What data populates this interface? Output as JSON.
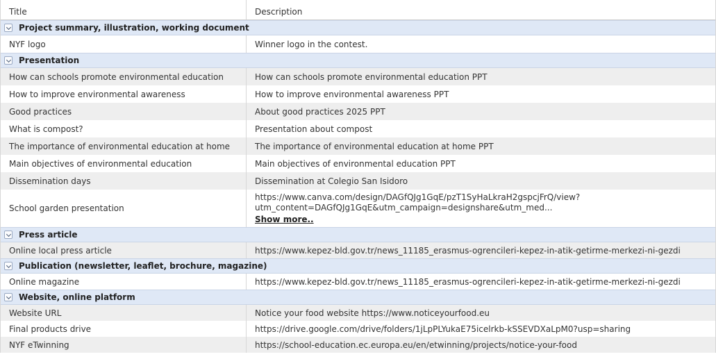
{
  "columns": {
    "title": "Title",
    "description": "Description"
  },
  "groups": [
    {
      "label": "Project summary, illustration, working document",
      "rows": [
        {
          "title": "NYF logo",
          "description": "Winner logo in the contest."
        }
      ]
    },
    {
      "label": "Presentation",
      "rows": [
        {
          "title": "How can schools promote environmental education",
          "description": "How can schools promote environmental education PPT"
        },
        {
          "title": "How to improve environmental awareness",
          "description": "How to improve environmental awareness PPT"
        },
        {
          "title": "Good practices",
          "description": "About good practices 2025 PPT"
        },
        {
          "title": "What is compost?",
          "description": "Presentation about compost"
        },
        {
          "title": "The importance of environmental education at home",
          "description": "The importance of environmental education at home PPT"
        },
        {
          "title": "Main objectives of environmental education",
          "description": "Main objectives of environmental education PPT"
        },
        {
          "title": "Dissemination days",
          "description": "Dissemination at Colegio San Isidoro"
        },
        {
          "title": "School garden presentation",
          "description_line1": "https://www.canva.com/design/DAGfQJg1GqE/pzT1SyHaLkraH2gspcjFrQ/view?",
          "description_line2": "utm_content=DAGfQJg1GqE&utm_campaign=designshare&utm_med...",
          "show_more": "Show more.."
        }
      ]
    },
    {
      "label": "Press article",
      "rows": [
        {
          "title": "Online local press article",
          "description": "https://www.kepez-bld.gov.tr/news_11185_erasmus-ogrencileri-kepez-in-atik-getirme-merkezi-ni-gezdi"
        }
      ]
    },
    {
      "label": "Publication (newsletter, leaflet, brochure, magazine)",
      "rows": [
        {
          "title": "Online magazine",
          "description": "https://www.kepez-bld.gov.tr/news_11185_erasmus-ogrencileri-kepez-in-atik-getirme-merkezi-ni-gezdi"
        }
      ]
    },
    {
      "label": "Website, online platform",
      "rows": [
        {
          "title": "Website URL",
          "description": "Notice your food website https://www.noticeyourfood.eu"
        },
        {
          "title": "Final products drive",
          "description": "https://drive.google.com/drive/folders/1jLpPLYukaE75icelrkb-kSSEVDXaLpM0?usp=sharing"
        },
        {
          "title": "NYF eTwinning",
          "description": "https://school-education.ec.europa.eu/en/etwinning/projects/notice-your-food"
        }
      ]
    }
  ]
}
